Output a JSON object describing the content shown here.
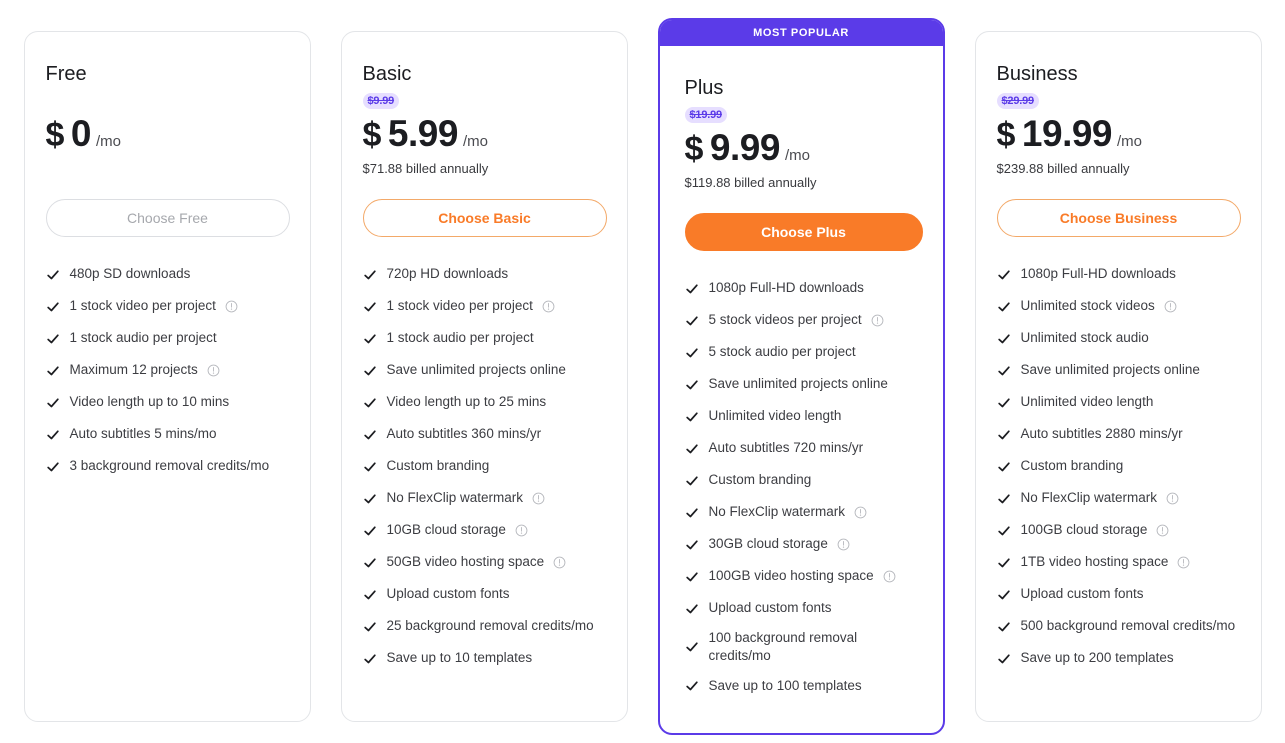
{
  "icons": {
    "check": "check-icon",
    "info": "info-icon"
  },
  "plans": [
    {
      "name": "Free",
      "currency": "$",
      "amount": "0",
      "period": "/mo",
      "old_price": "",
      "billed": "",
      "cta_label": "Choose Free",
      "cta_style": "disabled",
      "badge": "",
      "features": [
        {
          "text": "480p SD downloads",
          "info": false
        },
        {
          "text": "1 stock video per project",
          "info": true
        },
        {
          "text": "1 stock audio per project",
          "info": false
        },
        {
          "text": "Maximum 12 projects",
          "info": true
        },
        {
          "text": "Video length up to 10 mins",
          "info": false
        },
        {
          "text": "Auto subtitles 5 mins/mo",
          "info": false
        },
        {
          "text": "3 background removal credits/mo",
          "info": false
        }
      ]
    },
    {
      "name": "Basic",
      "currency": "$",
      "amount": "5.99",
      "period": "/mo",
      "old_price": "$9.99",
      "billed": "$71.88 billed annually",
      "cta_label": "Choose Basic",
      "cta_style": "outline",
      "badge": "",
      "features": [
        {
          "text": "720p HD downloads",
          "info": false
        },
        {
          "text": "1 stock video per project",
          "info": true
        },
        {
          "text": "1 stock audio per project",
          "info": false
        },
        {
          "text": "Save unlimited projects online",
          "info": false
        },
        {
          "text": "Video length up to 25 mins",
          "info": false
        },
        {
          "text": "Auto subtitles 360 mins/yr",
          "info": false
        },
        {
          "text": "Custom branding",
          "info": false
        },
        {
          "text": "No FlexClip watermark",
          "info": true
        },
        {
          "text": "10GB cloud storage",
          "info": true
        },
        {
          "text": "50GB video hosting space",
          "info": true
        },
        {
          "text": "Upload custom fonts",
          "info": false
        },
        {
          "text": "25 background removal credits/mo",
          "info": false
        },
        {
          "text": "Save up to 10 templates",
          "info": false
        }
      ]
    },
    {
      "name": "Plus",
      "currency": "$",
      "amount": "9.99",
      "period": "/mo",
      "old_price": "$19.99",
      "billed": "$119.88 billed annually",
      "cta_label": "Choose Plus",
      "cta_style": "solid",
      "badge": "MOST POPULAR",
      "features": [
        {
          "text": "1080p Full-HD downloads",
          "info": false
        },
        {
          "text": "5 stock videos per project",
          "info": true
        },
        {
          "text": "5 stock audio per project",
          "info": false
        },
        {
          "text": "Save unlimited projects online",
          "info": false
        },
        {
          "text": "Unlimited video length",
          "info": false
        },
        {
          "text": "Auto subtitles 720 mins/yr",
          "info": false
        },
        {
          "text": "Custom branding",
          "info": false
        },
        {
          "text": "No FlexClip watermark",
          "info": true
        },
        {
          "text": "30GB cloud storage",
          "info": true
        },
        {
          "text": "100GB video hosting space",
          "info": true
        },
        {
          "text": "Upload custom fonts",
          "info": false
        },
        {
          "text": "100 background removal credits/mo",
          "info": false
        },
        {
          "text": "Save up to 100 templates",
          "info": false
        }
      ]
    },
    {
      "name": "Business",
      "currency": "$",
      "amount": "19.99",
      "period": "/mo",
      "old_price": "$29.99",
      "billed": "$239.88 billed annually",
      "cta_label": "Choose Business",
      "cta_style": "outline",
      "badge": "",
      "features": [
        {
          "text": "1080p Full-HD downloads",
          "info": false
        },
        {
          "text": "Unlimited stock videos",
          "info": true
        },
        {
          "text": "Unlimited stock audio",
          "info": false
        },
        {
          "text": "Save unlimited projects online",
          "info": false
        },
        {
          "text": "Unlimited video length",
          "info": false
        },
        {
          "text": "Auto subtitles 2880 mins/yr",
          "info": false
        },
        {
          "text": "Custom branding",
          "info": false
        },
        {
          "text": "No FlexClip watermark",
          "info": true
        },
        {
          "text": "100GB cloud storage",
          "info": true
        },
        {
          "text": "1TB video hosting space",
          "info": true
        },
        {
          "text": "Upload custom fonts",
          "info": false
        },
        {
          "text": "500 background removal credits/mo",
          "info": false
        },
        {
          "text": "Save up to 200 templates",
          "info": false
        }
      ]
    }
  ],
  "colors": {
    "accent_purple": "#5B3BE8",
    "accent_orange": "#F97B28",
    "old_price_badge_bg": "#E6DEFF",
    "card_border": "#E3E5E8",
    "text_primary": "#1C1D21",
    "text_secondary": "#3C3D42"
  }
}
